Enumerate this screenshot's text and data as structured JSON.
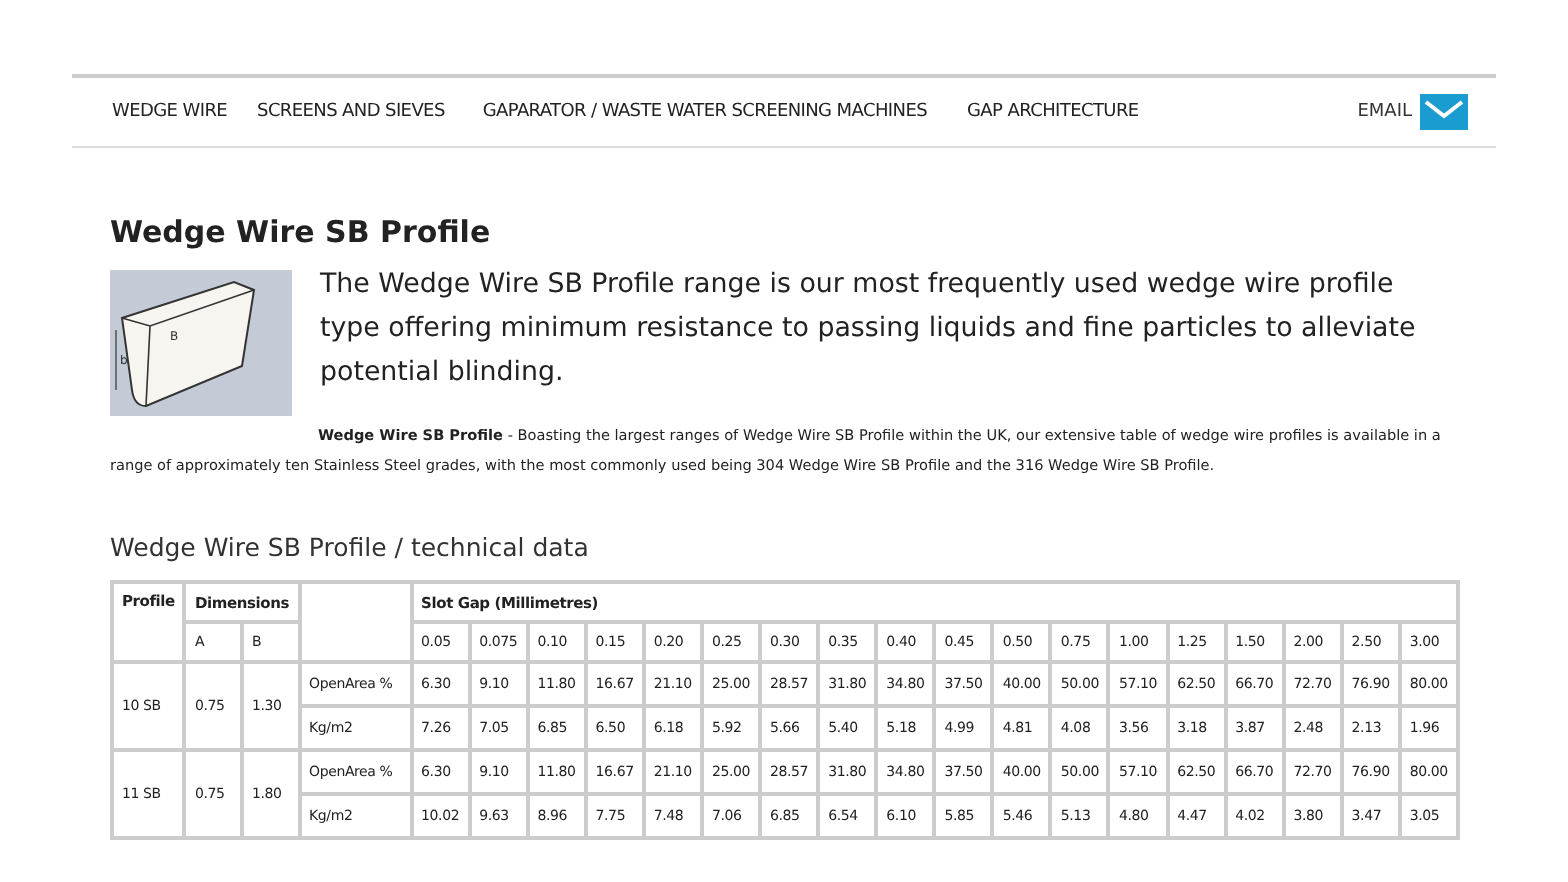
{
  "nav": {
    "items": [
      "WEDGE WIRE",
      "SCREENS AND SIEVES",
      "GAPARATOR / WASTE WATER SCREENING MACHINES",
      "GAP ARCHITECTURE"
    ],
    "email": "EMAIL"
  },
  "title": "Wedge Wire SB Profile",
  "intro": "The Wedge Wire SB Profile range is our most frequently used wedge wire profile type offering minimum resistance to passing liquids and fine particles to alleviate potential blinding.",
  "diagram_labels": [
    "B",
    "b"
  ],
  "description": "**Wedge Wire SB Profile** - Boasting the largest ranges of Wedge Wire SB Profile within the UK, our extensive table of wedge wire profiles is available in a range of approximately ten Stainless Steel grades, with the most commonly used being 304 Wedge Wire SB Profile and the 316 Wedge Wire SB Profile.",
  "table_title": "Wedge Wire SB Profile / technical data",
  "table": {
    "headers": {
      "profile": "Profile",
      "dimensions": "Dimensions",
      "slot_gap": "Slot Gap (Millimetres)",
      "dim_a": "A",
      "dim_b": "B"
    },
    "gaps": [
      "0.05",
      "0.075",
      "0.10",
      "0.15",
      "0.20",
      "0.25",
      "0.30",
      "0.35",
      "0.40",
      "0.45",
      "0.50",
      "0.75",
      "1.00",
      "1.25",
      "1.50",
      "2.00",
      "2.50",
      "3.00"
    ],
    "rows": [
      {
        "profile": "10 SB",
        "a": "0.75",
        "b": "1.30",
        "measures": [
          {
            "label": "OpenArea %",
            "values": [
              "6.30",
              "9.10",
              "11.80",
              "16.67",
              "21.10",
              "25.00",
              "28.57",
              "31.80",
              "34.80",
              "37.50",
              "40.00",
              "50.00",
              "57.10",
              "62.50",
              "66.70",
              "72.70",
              "76.90",
              "80.00"
            ]
          },
          {
            "label": "Kg/m2",
            "values": [
              "7.26",
              "7.05",
              "6.85",
              "6.50",
              "6.18",
              "5.92",
              "5.66",
              "5.40",
              "5.18",
              "4.99",
              "4.81",
              "4.08",
              "3.56",
              "3.18",
              "3.87",
              "2.48",
              "2.13",
              "1.96"
            ]
          }
        ]
      },
      {
        "profile": "11 SB",
        "a": "0.75",
        "b": "1.80",
        "measures": [
          {
            "label": "OpenArea %",
            "values": [
              "6.30",
              "9.10",
              "11.80",
              "16.67",
              "21.10",
              "25.00",
              "28.57",
              "31.80",
              "34.80",
              "37.50",
              "40.00",
              "50.00",
              "57.10",
              "62.50",
              "66.70",
              "72.70",
              "76.90",
              "80.00"
            ]
          },
          {
            "label": "Kg/m2",
            "values": [
              "10.02",
              "9.63",
              "8.96",
              "7.75",
              "7.48",
              "7.06",
              "6.85",
              "6.54",
              "6.10",
              "5.85",
              "5.46",
              "5.13",
              "4.80",
              "4.47",
              "4.02",
              "3.80",
              "3.47",
              "3.05"
            ]
          }
        ]
      }
    ]
  }
}
